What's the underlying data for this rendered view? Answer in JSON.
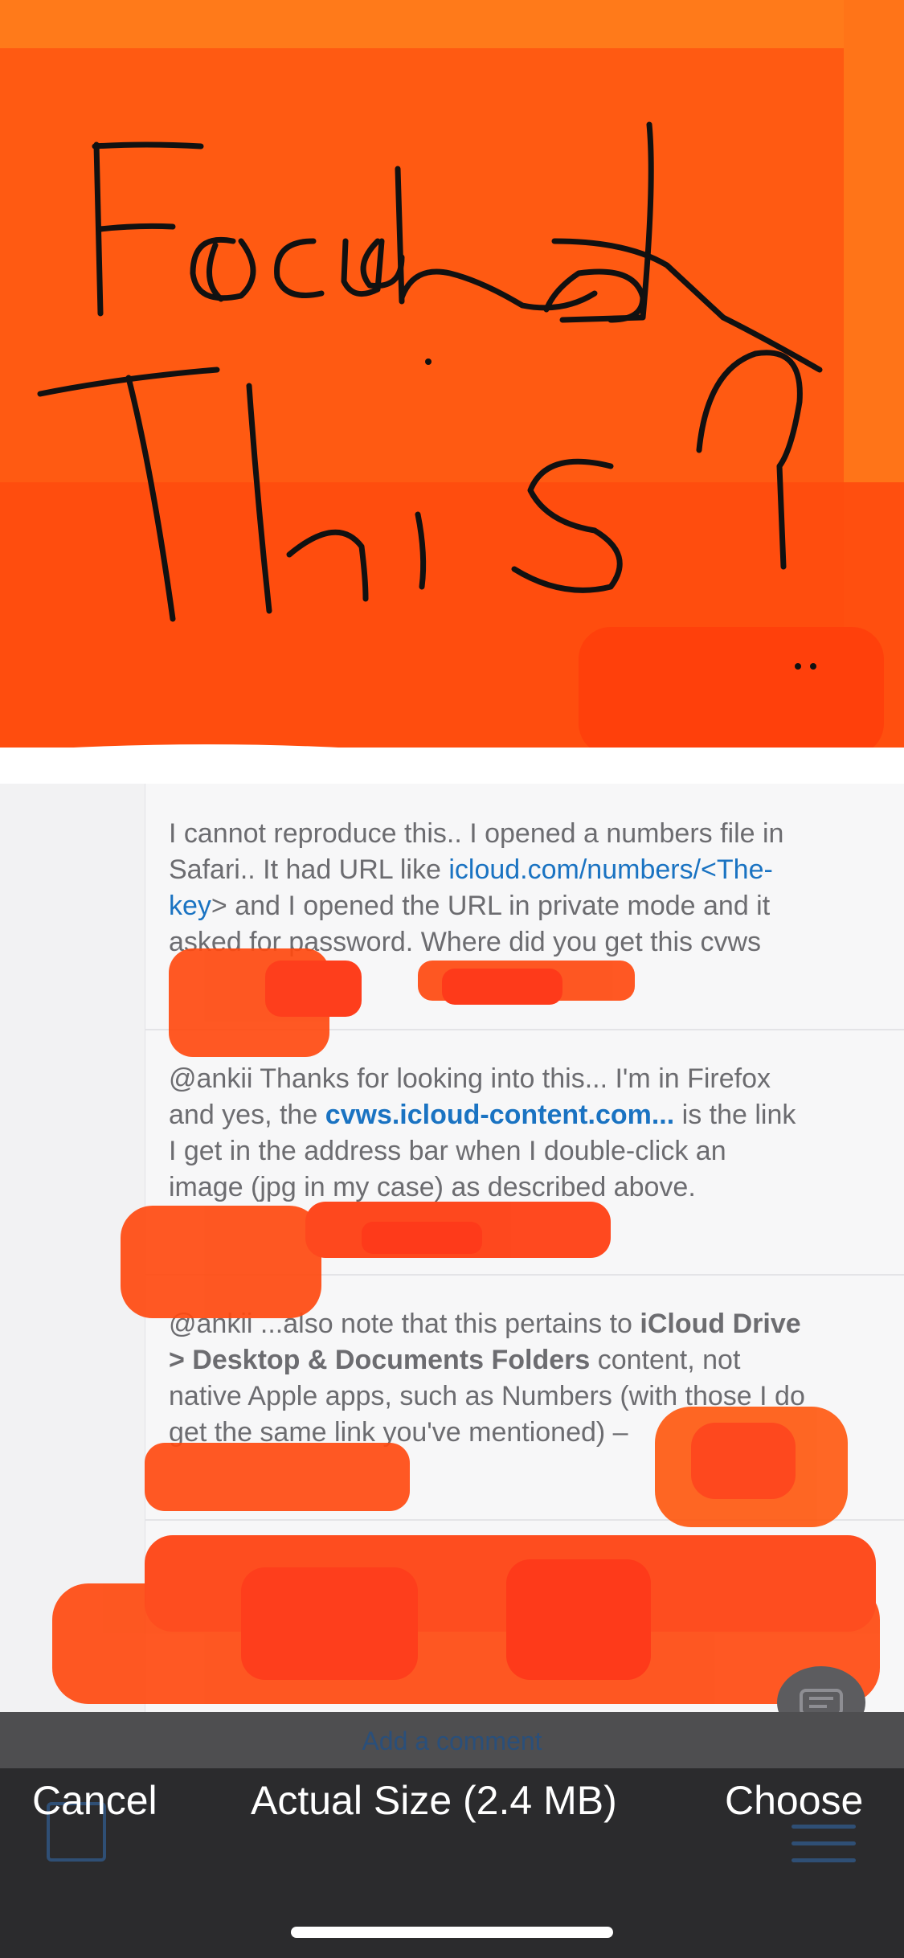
{
  "drawing": {
    "handwritten_text": "Found This?"
  },
  "comments": [
    {
      "lines": [
        {
          "text": "I cannot reproduce this.. I opened a numbers file in"
        },
        {
          "text": "Safari.. It had URL like ",
          "link": "icloud.com/numbers/<The-"
        },
        {
          "link": "key",
          "text": "> and I opened the URL in private mode and it"
        },
        {
          "text": "asked for password. Where did you get this cvws"
        }
      ]
    },
    {
      "lines": [
        {
          "text": "@ankii Thanks for looking into this... I'm in Firefox"
        },
        {
          "text": "and yes, the ",
          "link": "cvws.icloud-content.com...",
          "text2": " is the link"
        },
        {
          "text": "I get in the address bar when I double-click an"
        },
        {
          "text": "image (jpg in my case) as described above."
        }
      ]
    },
    {
      "lines": [
        {
          "text": "@ankii ...also note that this pertains to ",
          "bold": "iCloud Drive"
        },
        {
          "bold": "> Desktop & Documents Folders",
          "text": " content, not"
        },
        {
          "text": "native Apple apps, such as Numbers (with those I do"
        },
        {
          "text": "get the same link you've mentioned) –"
        }
      ]
    }
  ],
  "add_comment": "Add a comment",
  "toolbar": {
    "cancel": "Cancel",
    "size": "Actual Size (2.4 MB)",
    "choose": "Choose"
  },
  "colors": {
    "scribble_orange": "#ff5a12",
    "redact_orange": "#ff4a10",
    "link_blue": "#1a73c2",
    "toolbar_bg": "#2b2b2d"
  },
  "icons": [
    "comment-fab-icon",
    "share-icon",
    "list-icon"
  ]
}
